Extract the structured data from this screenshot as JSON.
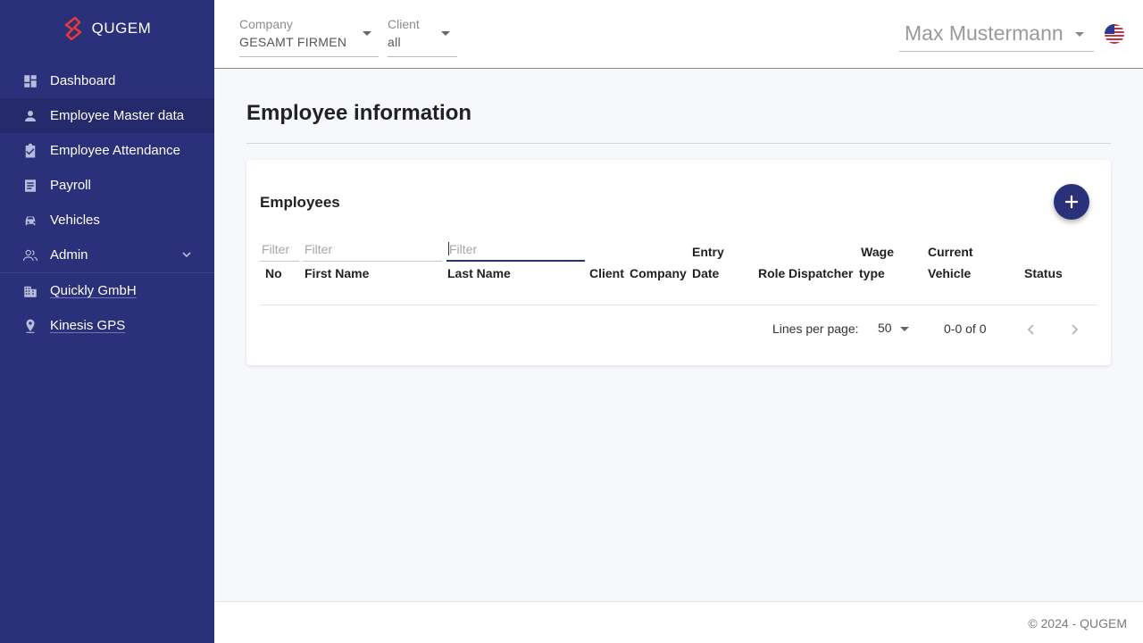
{
  "brand": {
    "name": "QUGEM",
    "accent": "#e53a3a",
    "sidebar_bg": "#2a3079"
  },
  "sidebar": {
    "items": [
      {
        "label": "Dashboard",
        "icon": "dashboard-icon"
      },
      {
        "label": "Employee Master data",
        "icon": "person-icon",
        "active": true
      },
      {
        "label": "Employee Attendance",
        "icon": "clipboard-check-icon"
      },
      {
        "label": "Payroll",
        "icon": "list-icon"
      },
      {
        "label": "Vehicles",
        "icon": "car-icon"
      },
      {
        "label": "Admin",
        "icon": "users-icon",
        "expandable": true
      },
      {
        "label": "Quickly GmbH",
        "icon": "building-icon"
      },
      {
        "label": "Kinesis GPS",
        "icon": "pin-icon"
      }
    ]
  },
  "topbar": {
    "company": {
      "label": "Company",
      "value": "GESAMT FIRMEN"
    },
    "client": {
      "label": "Client",
      "value": "all"
    },
    "user": {
      "name": "Max Mustermann"
    },
    "language": {
      "icon": "us-flag-icon"
    }
  },
  "main": {
    "title": "Employee information",
    "card": {
      "title": "Employees",
      "filters": {
        "no": {
          "placeholder": "Filter"
        },
        "first_name": {
          "placeholder": "Filter"
        },
        "last_name": {
          "placeholder": "Filter"
        }
      },
      "columns": [
        {
          "key": "no",
          "line1": "",
          "line2": "No"
        },
        {
          "key": "first_name",
          "line1": "",
          "line2": "First Name"
        },
        {
          "key": "last_name",
          "line1": "",
          "line2": "Last Name"
        },
        {
          "key": "client",
          "line1": "",
          "line2": "Client"
        },
        {
          "key": "company",
          "line1": "",
          "line2": "Company"
        },
        {
          "key": "entry_date",
          "line1": "Entry",
          "line2": "Date"
        },
        {
          "key": "role",
          "line1": "",
          "line2": "Role"
        },
        {
          "key": "dispatcher",
          "line1": "",
          "line2": "Dispatcher"
        },
        {
          "key": "wage_type",
          "line1": "Wage",
          "line2": "type"
        },
        {
          "key": "current_vehicle",
          "line1": "Current",
          "line2": "Vehicle"
        },
        {
          "key": "status",
          "line1": "",
          "line2": "Status"
        }
      ],
      "rows": [],
      "pagination": {
        "lines_label": "Lines per page:",
        "lines_value": "50",
        "range": "0-0 of 0"
      }
    }
  },
  "footer": {
    "text": "© 2024 - QUGEM"
  }
}
